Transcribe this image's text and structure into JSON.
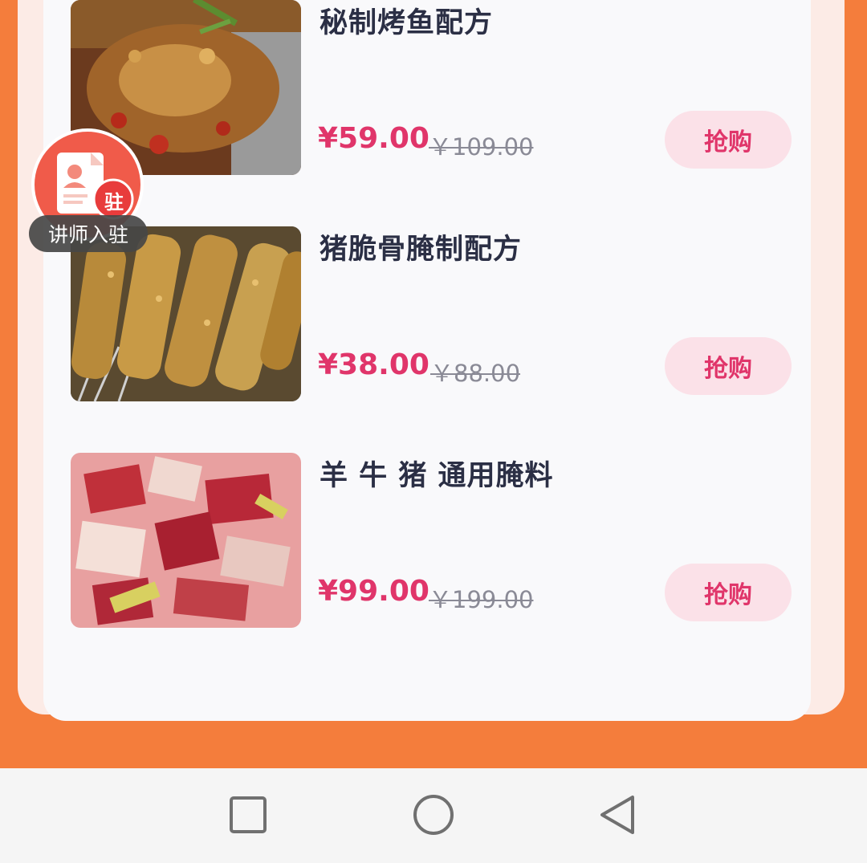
{
  "products": [
    {
      "title": "秘制烤鱼配方",
      "price": "¥59.00",
      "original_price": "￥109.00",
      "button": "抢购"
    },
    {
      "title": "猪脆骨腌制配方",
      "price": "¥38.00",
      "original_price": "￥88.00",
      "button": "抢购"
    },
    {
      "title": "羊 牛 猪 通用腌料",
      "price": "¥99.00",
      "original_price": "￥199.00",
      "button": "抢购"
    }
  ],
  "floating_badge": {
    "label": "讲师入驻",
    "icon_char": "驻"
  },
  "navigation": {
    "icons": [
      "recent-apps-icon",
      "home-icon",
      "back-icon"
    ]
  },
  "colors": {
    "background": "#f47d3c",
    "price": "#e0356a",
    "button_bg": "#fbe1e8",
    "title": "#2b2f45"
  }
}
